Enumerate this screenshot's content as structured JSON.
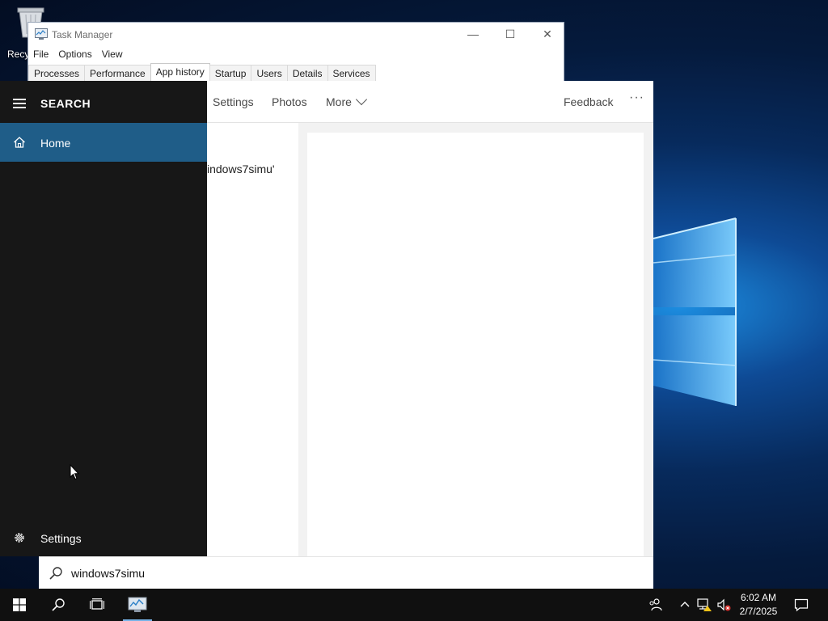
{
  "desktop": {
    "recycle_bin_label": "Recy"
  },
  "task_manager": {
    "title": "Task Manager",
    "controls": {
      "minimize": "—",
      "maximize": "☐",
      "close": "✕"
    },
    "menu": [
      "File",
      "Options",
      "View"
    ],
    "tabs": [
      "Processes",
      "Performance",
      "App history",
      "Startup",
      "Users",
      "Details",
      "Services"
    ],
    "active_tab": "App history"
  },
  "search": {
    "header": "SEARCH",
    "nav_home": "Home",
    "nav_settings": "Settings",
    "tabs": {
      "settings": "Settings",
      "photos": "Photos",
      "more": "More",
      "feedback": "Feedback",
      "ellipsis": "···"
    },
    "result_text": "indows7simu'",
    "query": "windows7simu"
  },
  "taskbar": {
    "time": "6:02 AM",
    "date": "2/7/2025"
  },
  "colors": {
    "nav_selected": "#1f5d88",
    "search_dark": "#171717",
    "taskbar": "#101010"
  }
}
